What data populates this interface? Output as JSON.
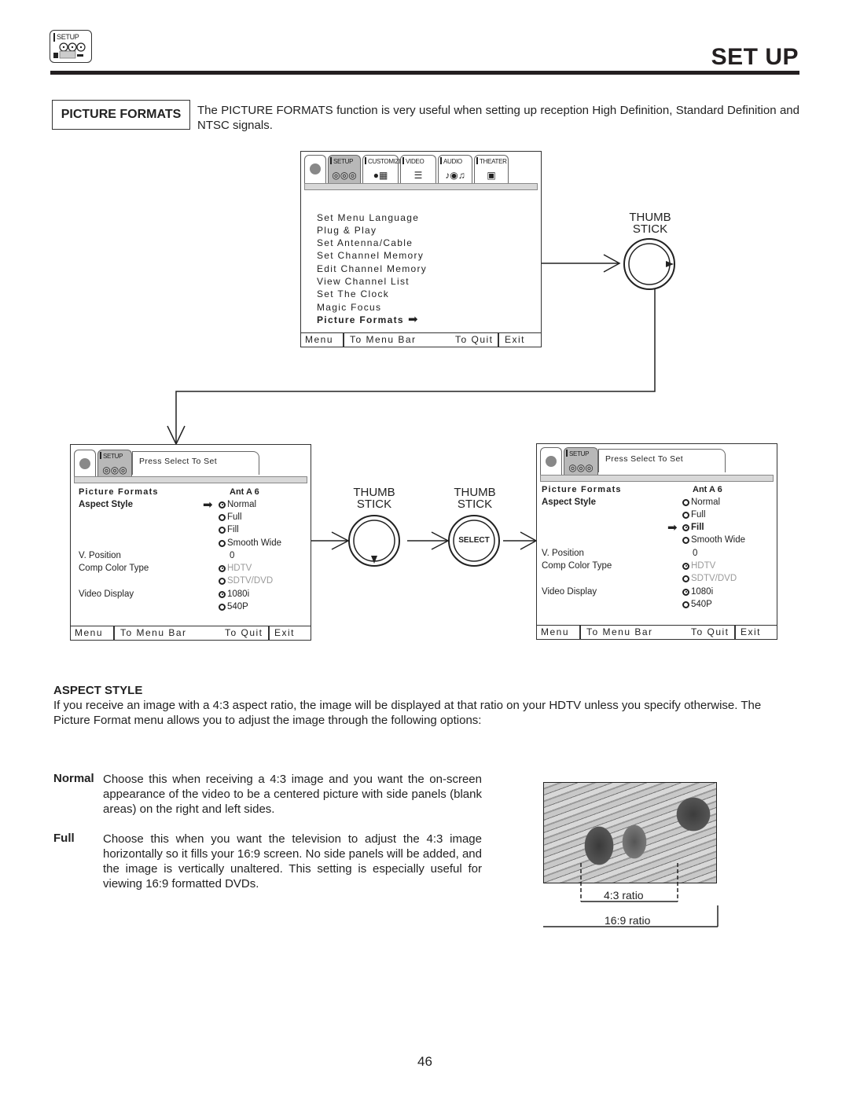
{
  "header": {
    "icon_label": "SETUP",
    "title": "SET UP"
  },
  "section": {
    "label": "PICTURE FORMATS",
    "intro": "The PICTURE FORMATS function is very useful when setting up reception High Definition, Standard Definition and NTSC signals."
  },
  "main_menu": {
    "tabs": [
      "SETUP",
      "CUSTOMIZE",
      "VIDEO",
      "AUDIO",
      "THEATER"
    ],
    "items": [
      "Set Menu Language",
      "Plug & Play",
      "Set Antenna/Cable",
      "Set Channel Memory",
      "Edit Channel Memory",
      "View Channel List",
      "Set The Clock",
      "Magic Focus",
      "Picture Formats"
    ],
    "selected_item": "Picture Formats",
    "footer": {
      "menu": "Menu",
      "to_menu_bar": "To Menu Bar",
      "to_quit": "To Quit",
      "exit": "Exit"
    }
  },
  "thumb_stick": {
    "line1": "THUMB",
    "line2": "STICK",
    "select_label": "SELECT"
  },
  "sub_menu_left": {
    "tab_label": "SETUP",
    "prompt": "Press Select To Set",
    "title": "Picture Formats",
    "channel": "Ant A 6",
    "rows": {
      "aspect_style": "Aspect Style",
      "v_position": "V. Position",
      "v_position_value": "0",
      "comp_color_type": "Comp Color Type",
      "video_display": "Video Display"
    },
    "aspect_options": [
      "Normal",
      "Full",
      "Fill",
      "Smooth Wide"
    ],
    "aspect_selected": "Normal",
    "color_options": [
      "HDTV",
      "SDTV/DVD"
    ],
    "color_selected": "HDTV",
    "display_options": [
      "1080i",
      "540P"
    ],
    "display_selected": "1080i",
    "footer": {
      "menu": "Menu",
      "to_menu_bar": "To Menu Bar",
      "to_quit": "To Quit",
      "exit": "Exit"
    }
  },
  "sub_menu_right": {
    "tab_label": "SETUP",
    "prompt": "Press Select To Set",
    "title": "Picture Formats",
    "channel": "Ant A 6",
    "rows": {
      "aspect_style": "Aspect Style",
      "v_position": "V. Position",
      "v_position_value": "0",
      "comp_color_type": "Comp Color Type",
      "video_display": "Video Display"
    },
    "aspect_options": [
      "Normal",
      "Full",
      "Fill",
      "Smooth Wide"
    ],
    "aspect_selected": "Fill",
    "color_options": [
      "HDTV",
      "SDTV/DVD"
    ],
    "color_selected": "HDTV",
    "display_options": [
      "1080i",
      "540P"
    ],
    "display_selected": "1080i",
    "footer": {
      "menu": "Menu",
      "to_menu_bar": "To Menu Bar",
      "to_quit": "To Quit",
      "exit": "Exit"
    }
  },
  "aspect_style": {
    "heading": "ASPECT STYLE",
    "intro": "If you receive an image with a 4:3 aspect ratio, the image will be displayed at that ratio on your HDTV unless you specify otherwise. The Picture Format menu allows you to adjust the image through the following options:",
    "options": [
      {
        "term": "Normal",
        "desc": "Choose this when receiving a 4:3 image and you want the on-screen appearance of the video to be a centered picture with side panels (blank areas) on the right and left sides."
      },
      {
        "term": "Full",
        "desc": "Choose this when you want the television to adjust the 4:3 image horizontally so it fills your 16:9 screen. No side panels will be added, and the image is vertically unaltered. This setting is especially useful for viewing 16:9 formatted DVDs."
      }
    ]
  },
  "illustration": {
    "ratio_43": "4:3 ratio",
    "ratio_169": "16:9 ratio"
  },
  "page_number": "46"
}
